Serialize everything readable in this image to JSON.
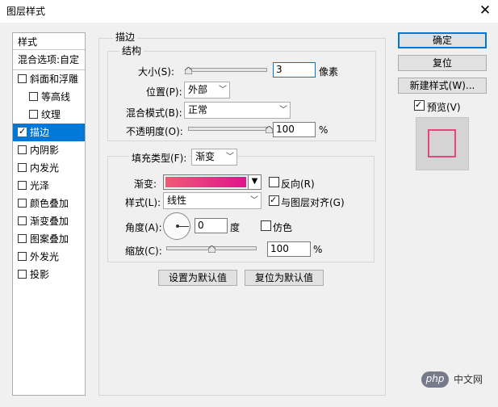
{
  "window": {
    "title": "图层样式",
    "close_glyph": "✕"
  },
  "sidebar": {
    "header": "样式",
    "blend_options": "混合选项:自定",
    "items": [
      {
        "label": "斜面和浮雕",
        "checked": false
      },
      {
        "label": "等高线",
        "checked": false
      },
      {
        "label": "纹理",
        "checked": false
      },
      {
        "label": "描边",
        "checked": true,
        "selected": true
      },
      {
        "label": "内阴影",
        "checked": false
      },
      {
        "label": "内发光",
        "checked": false
      },
      {
        "label": "光泽",
        "checked": false
      },
      {
        "label": "颜色叠加",
        "checked": false
      },
      {
        "label": "渐变叠加",
        "checked": false
      },
      {
        "label": "图案叠加",
        "checked": false
      },
      {
        "label": "外发光",
        "checked": false
      },
      {
        "label": "投影",
        "checked": false
      }
    ],
    "check_glyph": "✓"
  },
  "stroke": {
    "group_title": "描边",
    "structure_title": "结构",
    "size_label": "大小(S):",
    "size_value": "3",
    "size_unit": "像素",
    "position_label": "位置(P):",
    "position_value": "外部",
    "blend_label": "混合模式(B):",
    "blend_value": "正常",
    "opacity_label": "不透明度(O):",
    "opacity_value": "100",
    "opacity_unit": "%",
    "size_slider_fraction": 0.0,
    "opacity_slider_fraction": 1.0
  },
  "fill": {
    "fill_type_label": "填充类型(F):",
    "fill_type_value": "渐变",
    "gradient_label": "渐变:",
    "reverse_label": "反向(R)",
    "reverse_checked": false,
    "style_label": "样式(L):",
    "style_value": "线性",
    "align_label": "与图层对齐(G)",
    "align_checked": true,
    "angle_label": "角度(A):",
    "angle_value": "0",
    "angle_unit": "度",
    "dither_label": "仿色",
    "dither_checked": false,
    "scale_label": "缩放(C):",
    "scale_value": "100",
    "scale_unit": "%",
    "scale_slider_fraction": 0.5,
    "gradient_colors": [
      "#ef5a76",
      "#e0148c"
    ]
  },
  "buttons": {
    "make_default": "设置为默认值",
    "reset_default": "复位为默认值",
    "ok": "确定",
    "reset": "复位",
    "new_style": "新建样式(W)...",
    "preview_label": "预览(V)",
    "preview_checked": true
  },
  "preview": {
    "stroke_color": "#e8457a",
    "fill_color": "#d4d4d4"
  },
  "watermark": {
    "badge": "php",
    "text": "中文网"
  }
}
